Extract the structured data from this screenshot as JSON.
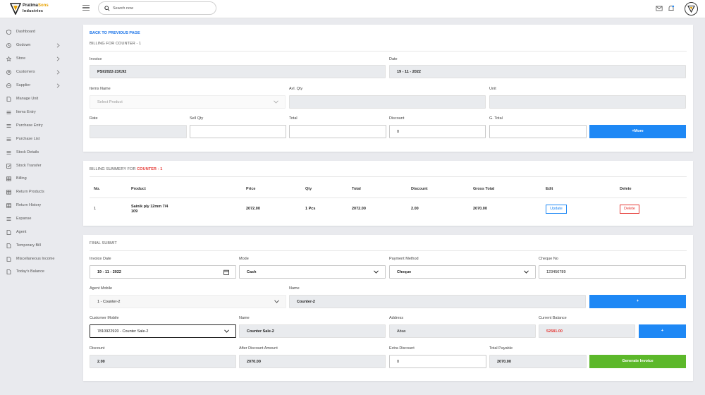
{
  "brand": {
    "name_part1": "Pratima",
    "name_highlight": "Sons",
    "name_part2": "Industries"
  },
  "header": {
    "search_placeholder": "Search now"
  },
  "sidebar": {
    "items": [
      {
        "label": "Dashboard",
        "icon": "shield-icon",
        "chevron": false
      },
      {
        "label": "Godown",
        "icon": "clock-icon",
        "chevron": true
      },
      {
        "label": "Store",
        "icon": "star-icon",
        "chevron": true
      },
      {
        "label": "Customers",
        "icon": "customers-icon",
        "chevron": true
      },
      {
        "label": "Supplier",
        "icon": "supplier-icon",
        "chevron": true
      },
      {
        "label": "Manage Unit",
        "icon": "document-icon",
        "chevron": false
      },
      {
        "label": "Items Entry",
        "icon": "list-icon",
        "chevron": false
      },
      {
        "label": "Purchase Entry",
        "icon": "list-icon",
        "chevron": false
      },
      {
        "label": "Purchase List",
        "icon": "list-icon",
        "chevron": false
      },
      {
        "label": "Stock Details",
        "icon": "list-icon",
        "chevron": false
      },
      {
        "label": "Stock Transfer",
        "icon": "checkbox-icon",
        "chevron": false
      },
      {
        "label": "Billing",
        "icon": "grid-icon",
        "chevron": false
      },
      {
        "label": "Return Products",
        "icon": "grid-icon",
        "chevron": false
      },
      {
        "label": "Return History",
        "icon": "grid-icon",
        "chevron": false
      },
      {
        "label": "Expanse",
        "icon": "list-icon",
        "chevron": false
      },
      {
        "label": "Agent",
        "icon": "document-icon",
        "chevron": false
      },
      {
        "label": "Temporary Bill",
        "icon": "document-icon",
        "chevron": false
      },
      {
        "label": "Miscellaneous Income",
        "icon": "document-icon",
        "chevron": false
      },
      {
        "label": "Today's Balance",
        "icon": "document-icon",
        "chevron": false
      }
    ]
  },
  "billing_form": {
    "back_link": "BACK TO PREVIOUS PAGE",
    "title": "BILLING FOR COUNTER - 1",
    "invoice_label": "Invoice",
    "invoice_value": "PSI/2022-23/192",
    "date_label": "Date",
    "date_value": "19 - 11 - 2022",
    "items_name_label": "Items Name",
    "items_name_placeholder": "Select Product",
    "avl_qty_label": "Avl. Qty",
    "unit_label": "Unit",
    "rate_label": "Rate",
    "sell_qty_label": "Sell Qty",
    "total_label": "Total",
    "discount_label": "Discount",
    "discount_value": "0",
    "gtotal_label": "G. Total",
    "more_button": "+More"
  },
  "billing_summary": {
    "title_prefix": "BILLING SUMMERY FOR",
    "title_highlight": "COUNTER - 1",
    "columns": [
      "No.",
      "Product",
      "Price",
      "Qty",
      "Total",
      "Discount",
      "Gross Total",
      "Edit",
      "Delete"
    ],
    "rows": [
      {
        "no": "1",
        "product_line1": "Sainik ply 12mm 7/4",
        "product_line2": "109",
        "price": "2072.00",
        "qty": "1 Pcs",
        "total": "2072.00",
        "discount": "2.00",
        "gross_total": "2070.00",
        "edit_label": "Update",
        "delete_label": "Delete"
      }
    ]
  },
  "final_submit": {
    "title": "FINAL SUBMIT",
    "invoice_date_label": "Invoice Date",
    "invoice_date_value": "19 - 11 - 2022",
    "mode_label": "Mode",
    "mode_value": "Cash",
    "payment_method_label": "Payment Method",
    "payment_method_value": "Cheque",
    "cheque_no_label": "Cheque No",
    "cheque_no_value": "123456789",
    "agent_mobile_label": "Agent Mobile",
    "agent_mobile_value": "1 - Counter-2",
    "name_label": "Name",
    "agent_name_value": "Counter-2",
    "agent_add_button": "+",
    "customer_mobile_label": "Customer Mobile",
    "customer_mobile_value": "7810922920 - Counter Sale-2",
    "customer_name_label": "Name",
    "customer_name_value": "Counter Sale-2",
    "address_label": "Address",
    "address_value": "Abas",
    "current_balance_label": "Current Balance",
    "current_balance_value": "52581.00",
    "customer_add_button": "+",
    "discount_label": "Discount",
    "discount_value": "2.00",
    "after_discount_label": "After Discount Amount",
    "after_discount_value": "2070.00",
    "extra_discount_label": "Extra Discount",
    "extra_discount_value": "0",
    "total_payable_label": "Total Payable",
    "total_payable_value": "2070.00",
    "generate_button": "Generate Invoice"
  },
  "colors": {
    "primary": "#1e88f5",
    "success": "#5cb82a",
    "danger": "#e53935",
    "logo_accent": "#e8a200"
  }
}
